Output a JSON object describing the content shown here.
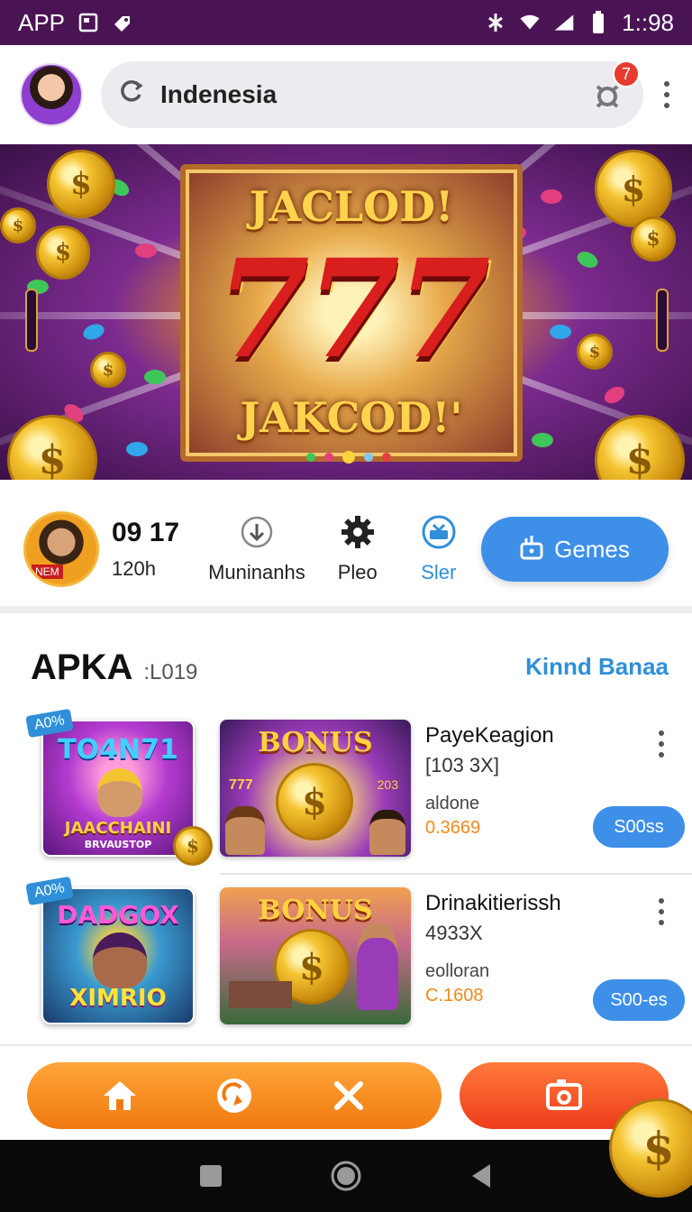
{
  "statusbar": {
    "app_label": "APP",
    "time": "1::98"
  },
  "search": {
    "value": "Indenesia",
    "notification_count": "7"
  },
  "banner": {
    "headline_top": "JACLOD!",
    "headline_sevens": "777",
    "headline_bottom": "JAKCOD!'"
  },
  "stats": {
    "avatar_tag": "NEM",
    "count": "09 17",
    "count_sub": "120h",
    "nav": [
      {
        "label": "Muninanhs",
        "icon": "download-icon"
      },
      {
        "label": "Pleo",
        "icon": "gear-icon"
      },
      {
        "label": "Sler",
        "icon": "tv-icon"
      }
    ],
    "games_button": "Gemes"
  },
  "section": {
    "title": "APKA",
    "subtitle": ":L019",
    "link": "Kinnd Banaa"
  },
  "games": [
    {
      "tag": "A0%",
      "thumb_title": "TO4N71",
      "thumb_caption": "JAACCHAINI",
      "thumb_sub": "BRVAUSTOP",
      "bonus": "BONUS",
      "bonus_sub": "777",
      "bonus_sub2": "203",
      "name": "PayeKeagion",
      "meta": "[103 3X]",
      "sub": "aldone",
      "value": "0.3669",
      "button": "S00ss"
    },
    {
      "tag": "A0%",
      "thumb_title": "DADGOX",
      "thumb_caption": "XIMRIO",
      "bonus": "BONUS",
      "name": "Drinakitierissh",
      "meta": "4933X",
      "sub": "eolloran",
      "value": "C.1608",
      "button": "S00-es"
    }
  ],
  "colors": {
    "statusbar": "#4a1454",
    "accent_blue": "#3d8fe8",
    "accent_orange": "#f07a10",
    "accent_red": "#ee3c1c",
    "value_orange": "#f08a1a"
  }
}
